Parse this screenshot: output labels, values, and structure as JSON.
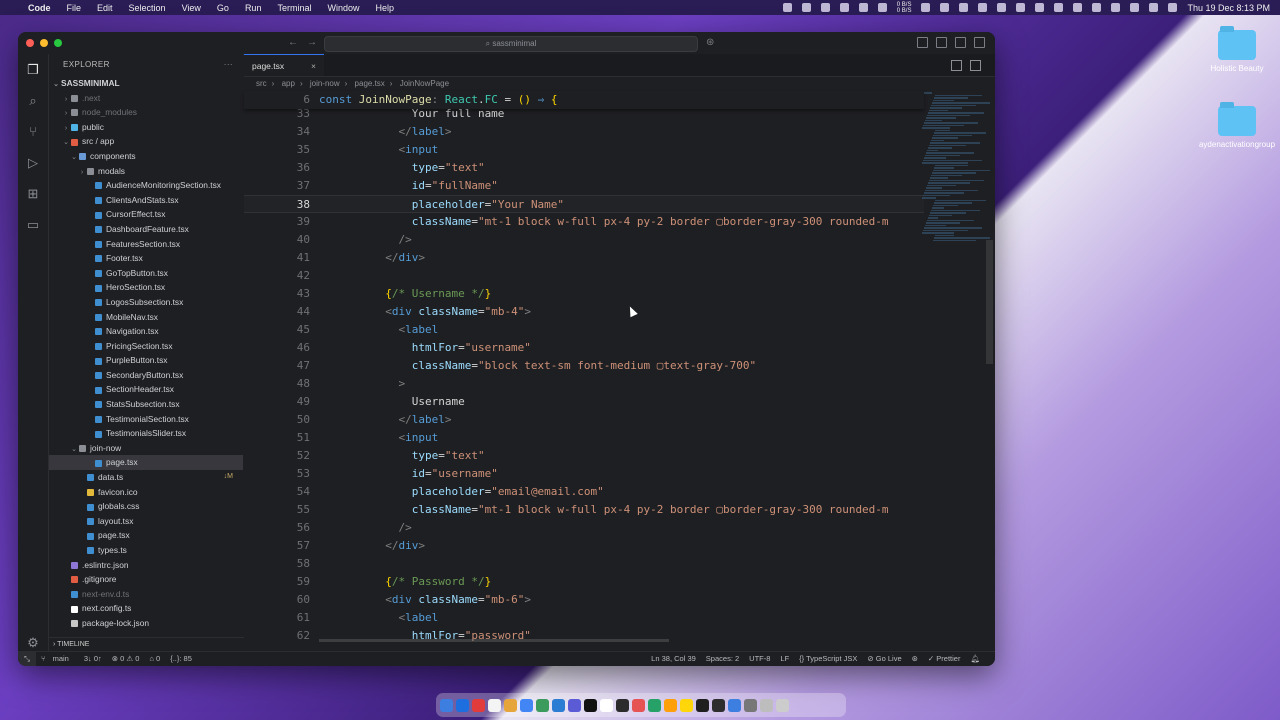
{
  "menubar": {
    "app": "Code",
    "menus": [
      "File",
      "Edit",
      "Selection",
      "View",
      "Go",
      "Run",
      "Terminal",
      "Window",
      "Help"
    ],
    "net_up": "0 B/S",
    "net_down": "0 B/S",
    "clock": "Thu 19 Dec  8:13 PM"
  },
  "desktop": {
    "icons": [
      {
        "label": "Holistic Beauty"
      },
      {
        "label": "aydenactivationgroup"
      }
    ]
  },
  "window": {
    "search": "sassminimal"
  },
  "explorer": {
    "title": "EXPLORER",
    "root": "SASSMINIMAL",
    "timeline": "TIMELINE",
    "items": [
      {
        "label": ".next",
        "indent": 1,
        "chev": "›",
        "color": "#8b8e95",
        "dim": true
      },
      {
        "label": "node_modules",
        "indent": 1,
        "chev": "›",
        "color": "#8b8e95",
        "dim": true
      },
      {
        "label": "public",
        "indent": 1,
        "chev": "›",
        "color": "#4fb3e6"
      },
      {
        "label": "src / app",
        "indent": 1,
        "chev": "⌄",
        "color": "#e05d44"
      },
      {
        "label": "components",
        "indent": 2,
        "chev": "⌄",
        "color": "#6a9ad6"
      },
      {
        "label": "modals",
        "indent": 3,
        "chev": "›",
        "color": "#8b8e95"
      },
      {
        "label": "AudienceMonitoringSection.tsx",
        "indent": 4,
        "color": "#3e8ed0"
      },
      {
        "label": "ClientsAndStats.tsx",
        "indent": 4,
        "color": "#3e8ed0"
      },
      {
        "label": "CursorEffect.tsx",
        "indent": 4,
        "color": "#3e8ed0"
      },
      {
        "label": "DashboardFeature.tsx",
        "indent": 4,
        "color": "#3e8ed0"
      },
      {
        "label": "FeaturesSection.tsx",
        "indent": 4,
        "color": "#3e8ed0"
      },
      {
        "label": "Footer.tsx",
        "indent": 4,
        "color": "#3e8ed0"
      },
      {
        "label": "GoTopButton.tsx",
        "indent": 4,
        "color": "#3e8ed0"
      },
      {
        "label": "HeroSection.tsx",
        "indent": 4,
        "color": "#3e8ed0"
      },
      {
        "label": "LogosSubsection.tsx",
        "indent": 4,
        "color": "#3e8ed0"
      },
      {
        "label": "MobileNav.tsx",
        "indent": 4,
        "color": "#3e8ed0"
      },
      {
        "label": "Navigation.tsx",
        "indent": 4,
        "color": "#3e8ed0"
      },
      {
        "label": "PricingSection.tsx",
        "indent": 4,
        "color": "#3e8ed0"
      },
      {
        "label": "PurpleButton.tsx",
        "indent": 4,
        "color": "#3e8ed0"
      },
      {
        "label": "SecondaryButton.tsx",
        "indent": 4,
        "color": "#3e8ed0"
      },
      {
        "label": "SectionHeader.tsx",
        "indent": 4,
        "color": "#3e8ed0"
      },
      {
        "label": "StatsSubsection.tsx",
        "indent": 4,
        "color": "#3e8ed0"
      },
      {
        "label": "TestimonialSection.tsx",
        "indent": 4,
        "color": "#3e8ed0"
      },
      {
        "label": "TestimonialsSlider.tsx",
        "indent": 4,
        "color": "#3e8ed0"
      },
      {
        "label": "join-now",
        "indent": 2,
        "chev": "⌄",
        "color": "#8b8e95"
      },
      {
        "label": "page.tsx",
        "indent": 4,
        "color": "#3e8ed0",
        "selected": true
      },
      {
        "label": "data.ts",
        "indent": 3,
        "color": "#3e8ed0",
        "badge": "↓M"
      },
      {
        "label": "favicon.ico",
        "indent": 3,
        "color": "#e2b93b"
      },
      {
        "label": "globals.css",
        "indent": 3,
        "color": "#3e8ed0"
      },
      {
        "label": "layout.tsx",
        "indent": 3,
        "color": "#3e8ed0"
      },
      {
        "label": "page.tsx",
        "indent": 3,
        "color": "#3e8ed0"
      },
      {
        "label": "types.ts",
        "indent": 3,
        "color": "#3e8ed0"
      },
      {
        "label": ".eslintrc.json",
        "indent": 1,
        "color": "#8e76d6"
      },
      {
        "label": ".gitignore",
        "indent": 1,
        "color": "#e05d44"
      },
      {
        "label": "next-env.d.ts",
        "indent": 1,
        "color": "#3e8ed0",
        "dim": true
      },
      {
        "label": "next.config.ts",
        "indent": 1,
        "color": "#ffffff"
      },
      {
        "label": "package-lock.json",
        "indent": 1,
        "color": "#c7c7c7"
      }
    ]
  },
  "editor": {
    "tab": "page.tsx",
    "breadcrumbs": [
      "src",
      "app",
      "join-now",
      "page.tsx",
      "JoinNowPage"
    ],
    "sticky": {
      "num": "6",
      "html": "<span class='k'>const</span> <span class='fn'>JoinNowPage</span><span class='p'>:</span> <span class='t'>React</span>.<span class='t'>FC</span> = <span class='y'>()</span> <span class='k'>⇒</span> <span class='y'>{</span>"
    },
    "current_line": "38",
    "lines": [
      {
        "num": "33",
        "html": "              Your full name"
      },
      {
        "num": "34",
        "html": "            <span class='p'>&lt;/</span><span class='k'>label</span><span class='p'>&gt;</span>"
      },
      {
        "num": "35",
        "html": "            <span class='p'>&lt;</span><span class='k'>input</span>"
      },
      {
        "num": "36",
        "html": "              <span class='a'>type</span>=<span class='s'>\"text\"</span>"
      },
      {
        "num": "37",
        "html": "              <span class='a'>id</span>=<span class='s'>\"fullName\"</span>"
      },
      {
        "num": "38",
        "html": "              <span class='a'>placeholder</span>=<span class='s'>\"Your Name\"</span>"
      },
      {
        "num": "39",
        "html": "              <span class='a'>className</span>=<span class='s'>\"mt-1 block w-full px-4 py-2 border ▢border-gray-300 rounded-m</span>"
      },
      {
        "num": "40",
        "html": "            <span class='p'>/&gt;</span>"
      },
      {
        "num": "41",
        "html": "          <span class='p'>&lt;/</span><span class='k'>div</span><span class='p'>&gt;</span>"
      },
      {
        "num": "42",
        "html": ""
      },
      {
        "num": "43",
        "html": "          <span class='y'>{</span><span class='c'>/* Username */</span><span class='y'>}</span>"
      },
      {
        "num": "44",
        "html": "          <span class='p'>&lt;</span><span class='k'>div</span> <span class='a'>className</span>=<span class='s'>\"mb-4\"</span><span class='p'>&gt;</span>"
      },
      {
        "num": "45",
        "html": "            <span class='p'>&lt;</span><span class='k'>label</span>"
      },
      {
        "num": "46",
        "html": "              <span class='a'>htmlFor</span>=<span class='s'>\"username\"</span>"
      },
      {
        "num": "47",
        "html": "              <span class='a'>className</span>=<span class='s'>\"block text-sm font-medium ▢text-gray-700\"</span>"
      },
      {
        "num": "48",
        "html": "            <span class='p'>&gt;</span>"
      },
      {
        "num": "49",
        "html": "              Username"
      },
      {
        "num": "50",
        "html": "            <span class='p'>&lt;/</span><span class='k'>label</span><span class='p'>&gt;</span>"
      },
      {
        "num": "51",
        "html": "            <span class='p'>&lt;</span><span class='k'>input</span>"
      },
      {
        "num": "52",
        "html": "              <span class='a'>type</span>=<span class='s'>\"text\"</span>"
      },
      {
        "num": "53",
        "html": "              <span class='a'>id</span>=<span class='s'>\"username\"</span>"
      },
      {
        "num": "54",
        "html": "              <span class='a'>placeholder</span>=<span class='s'>\"email@email.com\"</span>"
      },
      {
        "num": "55",
        "html": "              <span class='a'>className</span>=<span class='s'>\"mt-1 block w-full px-4 py-2 border ▢border-gray-300 rounded-m</span>"
      },
      {
        "num": "56",
        "html": "            <span class='p'>/&gt;</span>"
      },
      {
        "num": "57",
        "html": "          <span class='p'>&lt;/</span><span class='k'>div</span><span class='p'>&gt;</span>"
      },
      {
        "num": "58",
        "html": ""
      },
      {
        "num": "59",
        "html": "          <span class='y'>{</span><span class='c'>/* Password */</span><span class='y'>}</span>"
      },
      {
        "num": "60",
        "html": "          <span class='p'>&lt;</span><span class='k'>div</span> <span class='a'>className</span>=<span class='s'>\"mb-6\"</span><span class='p'>&gt;</span>"
      },
      {
        "num": "61",
        "html": "            <span class='p'>&lt;</span><span class='k'>label</span>"
      },
      {
        "num": "62",
        "html": "              <span class='a'>htmlFor</span>=<span class='s'>\"password\"</span>"
      }
    ]
  },
  "statusbar": {
    "branch": "main",
    "sync": "3↓ 0↑",
    "errors": "⊗ 0 ⚠ 0",
    "ports": "⌂ 0",
    "selection": "{..}: 85",
    "position": "Ln 38, Col 39",
    "spaces": "Spaces: 2",
    "encoding": "UTF-8",
    "eol": "LF",
    "language": "{} TypeScript JSX",
    "golive": "⊘ Go Live",
    "prettier": "✓ Prettier"
  },
  "dock": {
    "colors": [
      "#3c7fe0",
      "#1d6fe0",
      "#e23b3b",
      "#f4f4f4",
      "#e6a53a",
      "#4285f4",
      "#3a9b5c",
      "#2b7cd3",
      "#5b5bd6",
      "#111111",
      "#ffffff",
      "#2c2c2c",
      "#e55353",
      "#26a269",
      "#ff9f0a",
      "#ffd60a",
      "#1f1f1f",
      "#2e2e2e",
      "#3c7fe0",
      "#777777",
      "#bdbdbd",
      "#cccccc"
    ]
  }
}
